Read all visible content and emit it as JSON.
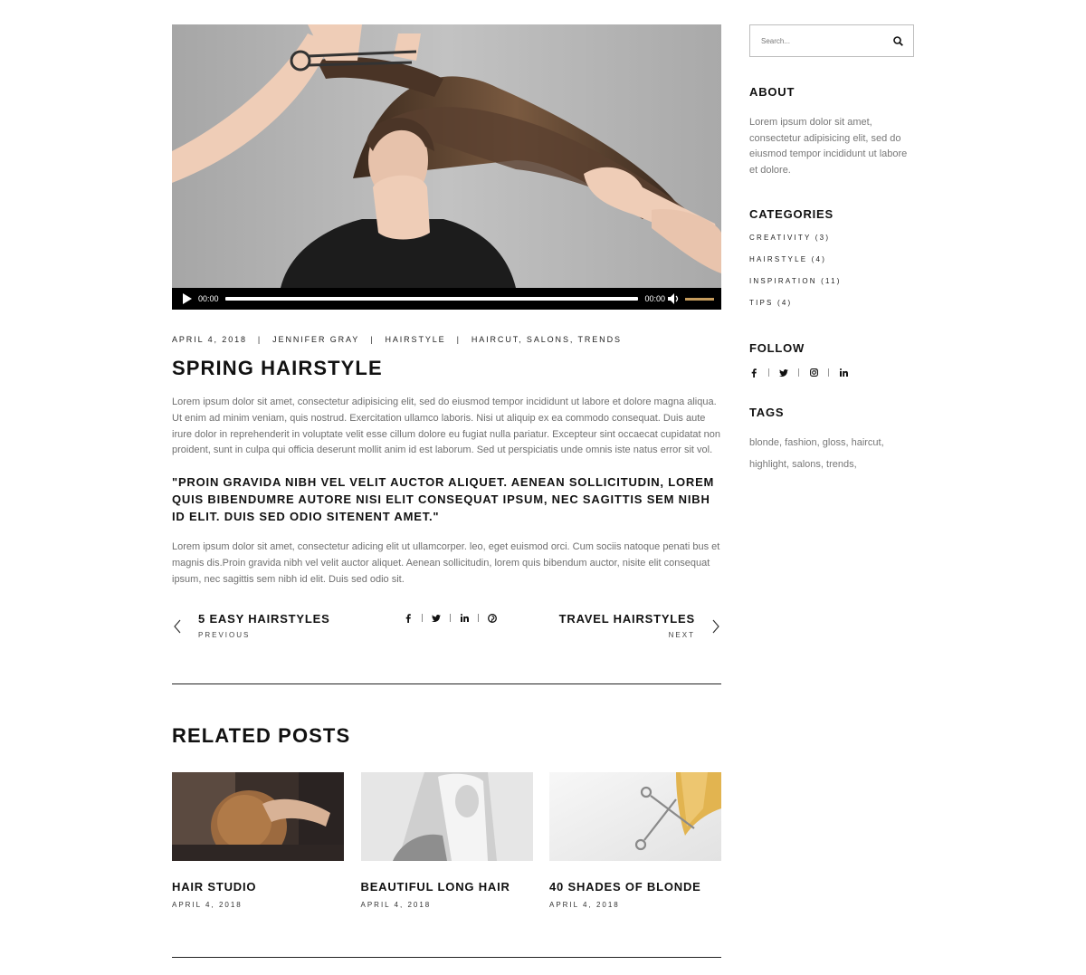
{
  "player": {
    "current_time": "00:00",
    "duration": "00:00",
    "progress": 0,
    "volume": 1.0
  },
  "post": {
    "date": "APRIL 4, 2018",
    "author": "JENNIFER GRAY",
    "category": "HAIRSTYLE",
    "tags": "HAIRCUT, SALONS, TRENDS",
    "title": "SPRING HAIRSTYLE",
    "paragraph1": "Lorem ipsum dolor sit amet, consectetur adipisicing elit, sed do eiusmod tempor incididunt ut labore et dolore magna aliqua. Ut enim ad minim veniam, quis nostrud. Exercitation ullamco laboris. Nisi ut aliquip ex ea commodo consequat. Duis aute irure dolor in reprehenderit in voluptate velit esse cillum dolore eu fugiat nulla pariatur. Excepteur sint occaecat cupidatat non proident, sunt in culpa qui officia deserunt mollit anim id est laborum. Sed ut perspiciatis unde omnis iste natus error sit vol.",
    "quote": "\"PROIN GRAVIDA NIBH VEL VELIT AUCTOR ALIQUET. AENEAN SOLLICITUDIN, LOREM QUIS BIBENDUMRE AUTORE NISI ELIT CONSEQUAT IPSUM, NEC SAGITTIS SEM NIBH ID ELIT. DUIS SED ODIO SITENENT AMET.\"",
    "paragraph2": "Lorem ipsum dolor sit amet, consectetur adicing elit ut ullamcorper. leo, eget euismod orci. Cum sociis natoque penati bus et magnis dis.Proin gravida nibh vel velit auctor aliquet. Aenean sollicitudin, lorem quis bibendum auctor, nisite elit consequat ipsum, nec sagittis sem nibh id elit. Duis sed odio sit."
  },
  "post_nav": {
    "prev_title": "5 EASY HAIRSTYLES",
    "prev_label": "PREVIOUS",
    "next_title": "TRAVEL HAIRSTYLES",
    "next_label": "NEXT",
    "share_icons": [
      "facebook-icon",
      "twitter-icon",
      "linkedin-icon",
      "pinterest-icon"
    ]
  },
  "related": {
    "title": "RELATED POSTS",
    "items": [
      {
        "title": "HAIR STUDIO",
        "date": "APRIL 4, 2018"
      },
      {
        "title": "BEAUTIFUL LONG HAIR",
        "date": "APRIL 4, 2018"
      },
      {
        "title": "40 SHADES OF BLONDE",
        "date": "APRIL 4, 2018"
      }
    ]
  },
  "sidebar": {
    "search_placeholder": "Search...",
    "about_title": "ABOUT",
    "about_text": "Lorem ipsum dolor sit amet, consectetur adipisicing elit, sed do eiusmod tempor incididunt ut labore et dolore.",
    "categories_title": "CATEGORIES",
    "categories": [
      "CREATIVITY (3)",
      "HAIRSTYLE (4)",
      "INSPIRATION (11)",
      "TIPS (4)"
    ],
    "follow_title": "FOLLOW",
    "follow_icons": [
      "facebook-icon",
      "twitter-icon",
      "instagram-icon",
      "linkedin-icon"
    ],
    "tags_title": "TAGS",
    "tags": [
      "blonde",
      "fashion",
      "gloss",
      "haircut",
      "highlight",
      "salons",
      "trends"
    ]
  },
  "colors": {
    "accent": "#c69c5d",
    "text": "#111111",
    "body_text": "#6f6f6f"
  }
}
